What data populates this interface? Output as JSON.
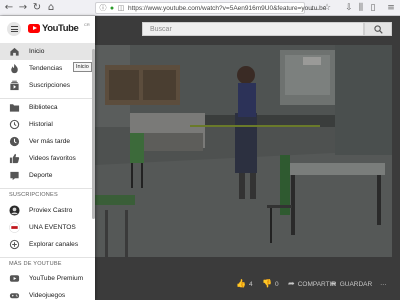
{
  "browser": {
    "back_glyph": "←",
    "forward_glyph": "→",
    "reload_glyph": "↻",
    "home_glyph": "⌂",
    "url": "https://www.youtube.com/watch?v=5Aen916m9U0&feature=youtu.be",
    "more_glyph": "…",
    "star_glyph": "☆",
    "download_glyph": "⇩",
    "library_glyph": "⫼",
    "sidebar_glyph": "▯",
    "menu_glyph": "≡"
  },
  "search": {
    "placeholder": "Buscar"
  },
  "video_actions": {
    "likes": "4",
    "dislikes": "0",
    "share_label": "COMPARTIR",
    "save_label": "GUARDAR",
    "more": "…"
  },
  "sidebar": {
    "logo_text": "YouTube",
    "logo_country": "CR",
    "items": [
      {
        "label": "Inicio",
        "icon": "home-icon"
      },
      {
        "label": "Tendencias",
        "icon": "flame-icon"
      },
      {
        "label": "Suscripciones",
        "icon": "subscriptions-icon"
      },
      {
        "label": "Biblioteca",
        "icon": "library-icon"
      },
      {
        "label": "Historial",
        "icon": "history-icon"
      },
      {
        "label": "Ver más tarde",
        "icon": "watch-later-icon"
      },
      {
        "label": "Videos favoritos",
        "icon": "thumbs-up-icon"
      },
      {
        "label": "Deporte",
        "icon": "sports-icon"
      }
    ],
    "subscriptions_title": "SUSCRIPCIONES",
    "subscriptions": [
      {
        "label": "Proviex Castro"
      },
      {
        "label": "UNA EVENTOS"
      },
      {
        "label": "Explorar canales"
      }
    ],
    "more_title": "MÁS DE YOUTUBE",
    "more_items": [
      {
        "label": "YouTube Premium"
      },
      {
        "label": "Videojuegos"
      }
    ],
    "tooltip": "Inicio"
  },
  "colors": {
    "brand": "#ff0000",
    "active_bg": "#e5e5e5"
  }
}
